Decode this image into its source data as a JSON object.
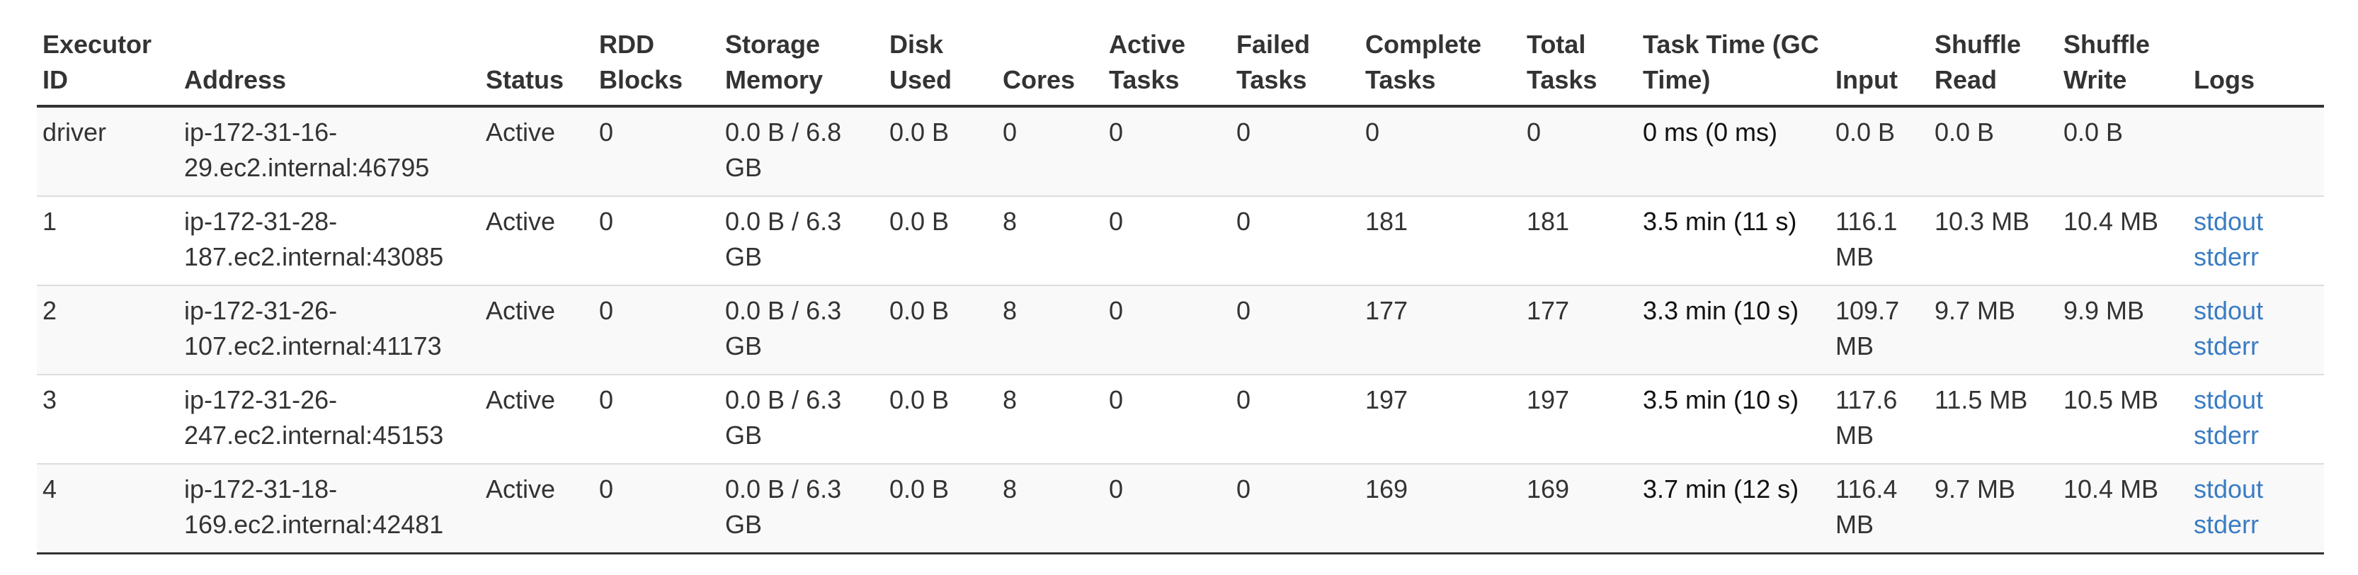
{
  "columns": [
    {
      "key": "id",
      "label": "Executor ID"
    },
    {
      "key": "address",
      "label": "Address"
    },
    {
      "key": "status",
      "label": "Status"
    },
    {
      "key": "rdd",
      "label": "RDD Blocks"
    },
    {
      "key": "storage",
      "label": "Storage Memory"
    },
    {
      "key": "disk",
      "label": "Disk Used"
    },
    {
      "key": "cores",
      "label": "Cores"
    },
    {
      "key": "active",
      "label": "Active Tasks"
    },
    {
      "key": "failed",
      "label": "Failed Tasks"
    },
    {
      "key": "complete",
      "label": "Complete Tasks"
    },
    {
      "key": "total",
      "label": "Total Tasks"
    },
    {
      "key": "tasktime",
      "label": "Task Time (GC Time)"
    },
    {
      "key": "input",
      "label": "Input"
    },
    {
      "key": "shuffle_read",
      "label": "Shuffle Read"
    },
    {
      "key": "shuffle_write",
      "label": "Shuffle Write"
    },
    {
      "key": "logs",
      "label": "Logs"
    }
  ],
  "rows": [
    {
      "id": "driver",
      "address": "ip-172-31-16-29.ec2.internal:46795",
      "status": "Active",
      "rdd": "0",
      "storage": "0.0 B / 6.8 GB",
      "disk": "0.0 B",
      "cores": "0",
      "active": "0",
      "failed": "0",
      "complete": "0",
      "total": "0",
      "tasktime": "0 ms (0 ms)",
      "input": "0.0 B",
      "shuffle_read": "0.0 B",
      "shuffle_write": "0.0 B",
      "logs": []
    },
    {
      "id": "1",
      "address": "ip-172-31-28-187.ec2.internal:43085",
      "status": "Active",
      "rdd": "0",
      "storage": "0.0 B / 6.3 GB",
      "disk": "0.0 B",
      "cores": "8",
      "active": "0",
      "failed": "0",
      "complete": "181",
      "total": "181",
      "tasktime": "3.5 min (11 s)",
      "input": "116.1 MB",
      "shuffle_read": "10.3 MB",
      "shuffle_write": "10.4 MB",
      "logs": [
        "stdout",
        "stderr"
      ]
    },
    {
      "id": "2",
      "address": "ip-172-31-26-107.ec2.internal:41173",
      "status": "Active",
      "rdd": "0",
      "storage": "0.0 B / 6.3 GB",
      "disk": "0.0 B",
      "cores": "8",
      "active": "0",
      "failed": "0",
      "complete": "177",
      "total": "177",
      "tasktime": "3.3 min (10 s)",
      "input": "109.7 MB",
      "shuffle_read": "9.7 MB",
      "shuffle_write": "9.9 MB",
      "logs": [
        "stdout",
        "stderr"
      ]
    },
    {
      "id": "3",
      "address": "ip-172-31-26-247.ec2.internal:45153",
      "status": "Active",
      "rdd": "0",
      "storage": "0.0 B / 6.3 GB",
      "disk": "0.0 B",
      "cores": "8",
      "active": "0",
      "failed": "0",
      "complete": "197",
      "total": "197",
      "tasktime": "3.5 min (10 s)",
      "input": "117.6 MB",
      "shuffle_read": "11.5 MB",
      "shuffle_write": "10.5 MB",
      "logs": [
        "stdout",
        "stderr"
      ]
    },
    {
      "id": "4",
      "address": "ip-172-31-18-169.ec2.internal:42481",
      "status": "Active",
      "rdd": "0",
      "storage": "0.0 B / 6.3 GB",
      "disk": "0.0 B",
      "cores": "8",
      "active": "0",
      "failed": "0",
      "complete": "169",
      "total": "169",
      "tasktime": "3.7 min (12 s)",
      "input": "116.4 MB",
      "shuffle_read": "9.7 MB",
      "shuffle_write": "10.4 MB",
      "logs": [
        "stdout",
        "stderr"
      ]
    }
  ],
  "colors": {
    "text": "#333333",
    "link": "#3a7cc2",
    "row_stripe": "#f9f9f9",
    "row_border": "#dddddd"
  }
}
